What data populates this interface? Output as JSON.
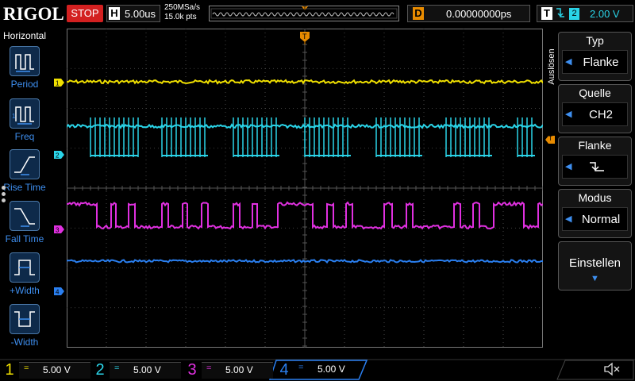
{
  "topbar": {
    "logo": "RIGOL",
    "run_state": "STOP",
    "timebase_letter": "H",
    "timebase": "5.00us",
    "sample_rate": "250MSa/s",
    "memory_depth": "15.0k pts",
    "trigger_pos_marker": "T",
    "delay_letter": "D",
    "delay": "0.00000000ps",
    "trigger_letter": "T",
    "trigger_edge_symbol": "⮥",
    "trigger_source": "2",
    "trigger_level": "2.00 V"
  },
  "left_panel": {
    "title": "Horizontal",
    "items": [
      {
        "label": "Period",
        "icon": "period-icon"
      },
      {
        "label": "Freq",
        "icon": "frequency-icon"
      },
      {
        "label": "Rise Time",
        "icon": "rise-time-icon"
      },
      {
        "label": "Fall Time",
        "icon": "fall-time-icon"
      },
      {
        "label": "+Width",
        "icon": "positive-width-icon"
      },
      {
        "label": "-Width",
        "icon": "negative-width-icon"
      }
    ]
  },
  "right_menu": {
    "side_label": "Auslösen",
    "sections": [
      {
        "title": "Typ",
        "value": "Flanke"
      },
      {
        "title": "Quelle",
        "value": "CH2"
      },
      {
        "title": "Flanke",
        "value": "falling-edge-icon"
      },
      {
        "title": "Modus",
        "value": "Normal"
      },
      {
        "title": "Einstellen",
        "value": "▼"
      }
    ]
  },
  "channels": [
    {
      "num": "1",
      "color": "#f0e000",
      "coupling": "=",
      "scale": "5.00 V"
    },
    {
      "num": "2",
      "color": "#2ad4e8",
      "coupling": "=",
      "scale": "5.00 V"
    },
    {
      "num": "3",
      "color": "#e030e0",
      "coupling": "=",
      "scale": "5.00 V"
    },
    {
      "num": "4",
      "color": "#2a7ff0",
      "coupling": "=",
      "scale": "5.00 V"
    }
  ],
  "markers": {
    "trigger_level_tag": "T"
  },
  "colors": {
    "accent": "#3e8ff0",
    "stop": "#d32020",
    "delay": "#e88b00",
    "grid": "#555555"
  }
}
